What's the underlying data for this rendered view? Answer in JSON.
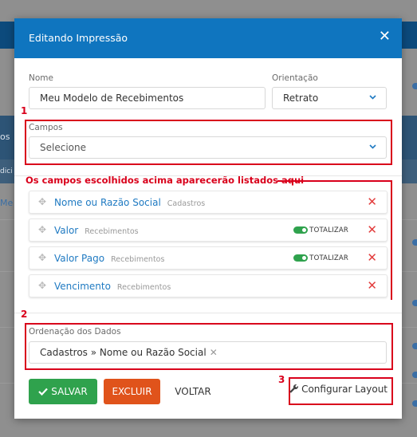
{
  "modal": {
    "title": "Editando Impressão",
    "close_glyph": "✕"
  },
  "form": {
    "nome_label": "Nome",
    "nome_value": "Meu Modelo de Recebimentos",
    "orientacao_label": "Orientação",
    "orientacao_value": "Retrato",
    "campos_label": "Campos",
    "campos_placeholder": "Selecione",
    "ordenacao_label": "Ordenação dos Dados",
    "ordenacao_tag": "Cadastros » Nome ou Razão Social",
    "ordenacao_tag_remove": "✕"
  },
  "annotations": {
    "marker_1": "1",
    "marker_2": "2",
    "marker_3": "3",
    "note": "Os campos escolhidos acima aparecerão listados aqui",
    "color": "#d9001b"
  },
  "fields": [
    {
      "name": "Nome ou Razão Social",
      "source": "Cadastros",
      "totalizar": false
    },
    {
      "name": "Valor",
      "source": "Recebimentos",
      "totalizar": true,
      "toggle_label": "TOTALIZAR"
    },
    {
      "name": "Valor Pago",
      "source": "Recebimentos",
      "totalizar": true,
      "toggle_label": "TOTALIZAR"
    },
    {
      "name": "Vencimento",
      "source": "Recebimentos",
      "totalizar": false
    }
  ],
  "icons": {
    "drag": "drag-handle-icon",
    "remove": "close-icon",
    "chevron": "chevron-down-icon",
    "wrench": "wrench-icon",
    "check": "check-icon"
  },
  "buttons": {
    "save": "SALVAR",
    "delete": "EXCLUIR",
    "back": "VOLTAR",
    "layout": "Configurar Layout"
  },
  "background": {
    "side_text_1": "os",
    "side_text_2": "dici",
    "side_text_3": "Me"
  },
  "colors": {
    "header": "#0f75bf",
    "save": "#2fa24d",
    "delete": "#e0531b",
    "link": "#1f7ac2"
  }
}
